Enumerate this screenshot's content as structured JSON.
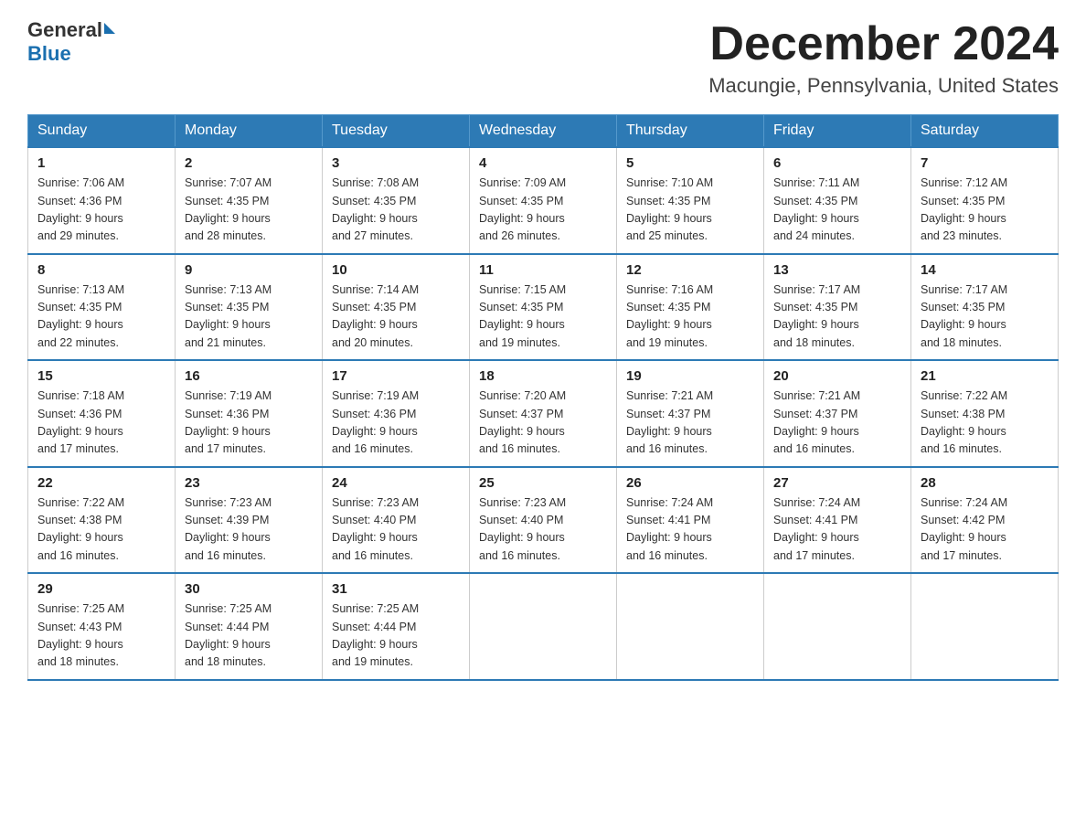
{
  "header": {
    "logo_text_general": "General",
    "logo_text_blue": "Blue",
    "month_title": "December 2024",
    "location": "Macungie, Pennsylvania, United States"
  },
  "weekdays": [
    "Sunday",
    "Monday",
    "Tuesday",
    "Wednesday",
    "Thursday",
    "Friday",
    "Saturday"
  ],
  "weeks": [
    [
      {
        "day": "1",
        "sunrise": "7:06 AM",
        "sunset": "4:36 PM",
        "daylight": "9 hours and 29 minutes."
      },
      {
        "day": "2",
        "sunrise": "7:07 AM",
        "sunset": "4:35 PM",
        "daylight": "9 hours and 28 minutes."
      },
      {
        "day": "3",
        "sunrise": "7:08 AM",
        "sunset": "4:35 PM",
        "daylight": "9 hours and 27 minutes."
      },
      {
        "day": "4",
        "sunrise": "7:09 AM",
        "sunset": "4:35 PM",
        "daylight": "9 hours and 26 minutes."
      },
      {
        "day": "5",
        "sunrise": "7:10 AM",
        "sunset": "4:35 PM",
        "daylight": "9 hours and 25 minutes."
      },
      {
        "day": "6",
        "sunrise": "7:11 AM",
        "sunset": "4:35 PM",
        "daylight": "9 hours and 24 minutes."
      },
      {
        "day": "7",
        "sunrise": "7:12 AM",
        "sunset": "4:35 PM",
        "daylight": "9 hours and 23 minutes."
      }
    ],
    [
      {
        "day": "8",
        "sunrise": "7:13 AM",
        "sunset": "4:35 PM",
        "daylight": "9 hours and 22 minutes."
      },
      {
        "day": "9",
        "sunrise": "7:13 AM",
        "sunset": "4:35 PM",
        "daylight": "9 hours and 21 minutes."
      },
      {
        "day": "10",
        "sunrise": "7:14 AM",
        "sunset": "4:35 PM",
        "daylight": "9 hours and 20 minutes."
      },
      {
        "day": "11",
        "sunrise": "7:15 AM",
        "sunset": "4:35 PM",
        "daylight": "9 hours and 19 minutes."
      },
      {
        "day": "12",
        "sunrise": "7:16 AM",
        "sunset": "4:35 PM",
        "daylight": "9 hours and 19 minutes."
      },
      {
        "day": "13",
        "sunrise": "7:17 AM",
        "sunset": "4:35 PM",
        "daylight": "9 hours and 18 minutes."
      },
      {
        "day": "14",
        "sunrise": "7:17 AM",
        "sunset": "4:35 PM",
        "daylight": "9 hours and 18 minutes."
      }
    ],
    [
      {
        "day": "15",
        "sunrise": "7:18 AM",
        "sunset": "4:36 PM",
        "daylight": "9 hours and 17 minutes."
      },
      {
        "day": "16",
        "sunrise": "7:19 AM",
        "sunset": "4:36 PM",
        "daylight": "9 hours and 17 minutes."
      },
      {
        "day": "17",
        "sunrise": "7:19 AM",
        "sunset": "4:36 PM",
        "daylight": "9 hours and 16 minutes."
      },
      {
        "day": "18",
        "sunrise": "7:20 AM",
        "sunset": "4:37 PM",
        "daylight": "9 hours and 16 minutes."
      },
      {
        "day": "19",
        "sunrise": "7:21 AM",
        "sunset": "4:37 PM",
        "daylight": "9 hours and 16 minutes."
      },
      {
        "day": "20",
        "sunrise": "7:21 AM",
        "sunset": "4:37 PM",
        "daylight": "9 hours and 16 minutes."
      },
      {
        "day": "21",
        "sunrise": "7:22 AM",
        "sunset": "4:38 PM",
        "daylight": "9 hours and 16 minutes."
      }
    ],
    [
      {
        "day": "22",
        "sunrise": "7:22 AM",
        "sunset": "4:38 PM",
        "daylight": "9 hours and 16 minutes."
      },
      {
        "day": "23",
        "sunrise": "7:23 AM",
        "sunset": "4:39 PM",
        "daylight": "9 hours and 16 minutes."
      },
      {
        "day": "24",
        "sunrise": "7:23 AM",
        "sunset": "4:40 PM",
        "daylight": "9 hours and 16 minutes."
      },
      {
        "day": "25",
        "sunrise": "7:23 AM",
        "sunset": "4:40 PM",
        "daylight": "9 hours and 16 minutes."
      },
      {
        "day": "26",
        "sunrise": "7:24 AM",
        "sunset": "4:41 PM",
        "daylight": "9 hours and 16 minutes."
      },
      {
        "day": "27",
        "sunrise": "7:24 AM",
        "sunset": "4:41 PM",
        "daylight": "9 hours and 17 minutes."
      },
      {
        "day": "28",
        "sunrise": "7:24 AM",
        "sunset": "4:42 PM",
        "daylight": "9 hours and 17 minutes."
      }
    ],
    [
      {
        "day": "29",
        "sunrise": "7:25 AM",
        "sunset": "4:43 PM",
        "daylight": "9 hours and 18 minutes."
      },
      {
        "day": "30",
        "sunrise": "7:25 AM",
        "sunset": "4:44 PM",
        "daylight": "9 hours and 18 minutes."
      },
      {
        "day": "31",
        "sunrise": "7:25 AM",
        "sunset": "4:44 PM",
        "daylight": "9 hours and 19 minutes."
      },
      null,
      null,
      null,
      null
    ]
  ],
  "labels": {
    "sunrise": "Sunrise:",
    "sunset": "Sunset:",
    "daylight": "Daylight:"
  }
}
